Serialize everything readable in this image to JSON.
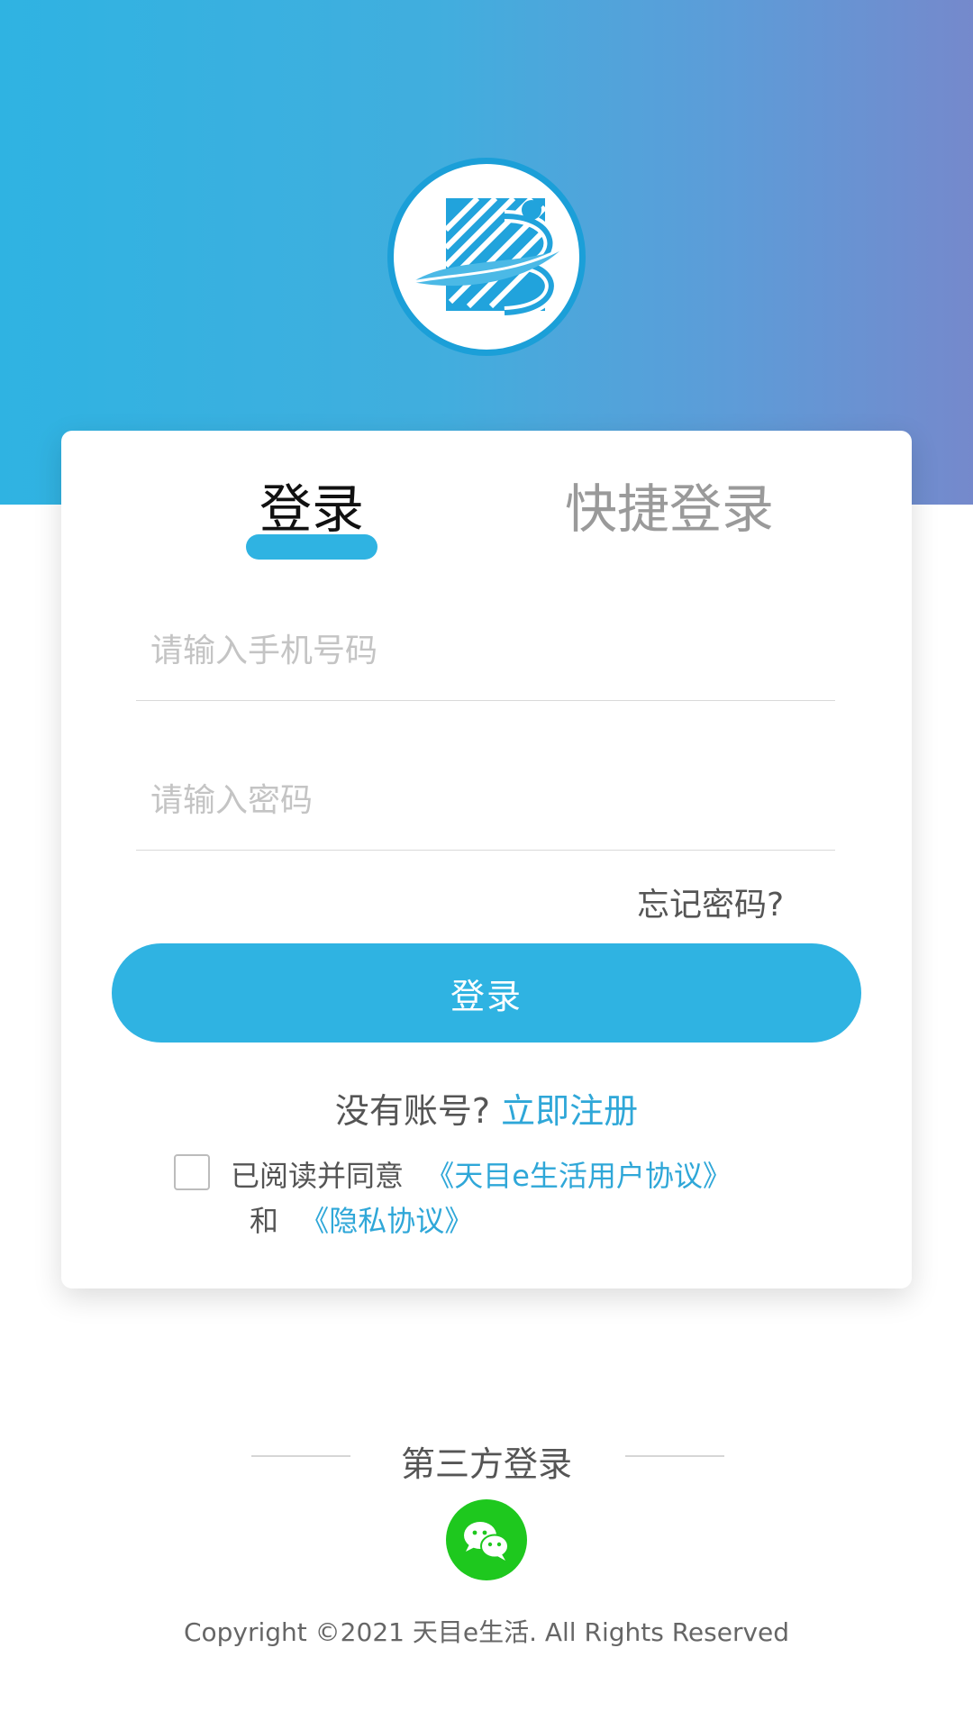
{
  "header": {
    "logo_icon": "app-logo-icon"
  },
  "tabs": [
    {
      "label": "登录",
      "active": true
    },
    {
      "label": "快捷登录",
      "active": false
    }
  ],
  "form": {
    "phone_placeholder": "请输入手机号码",
    "password_placeholder": "请输入密码",
    "forgot_label": "忘记密码?",
    "login_button": "登录"
  },
  "register": {
    "prompt": "没有账号?",
    "link": "立即注册"
  },
  "agreement": {
    "prefix": "已阅读并同意",
    "user_agreement": "《天目e生活用户协议》",
    "and": "和",
    "privacy": "《隐私协议》",
    "checked": false
  },
  "third_party": {
    "title": "第三方登录",
    "icon": "wechat-icon"
  },
  "footer": {
    "copyright": "Copyright ©2021 天目e生活. All Rights Reserved"
  },
  "colors": {
    "accent": "#2fb3e2",
    "link": "#2fa7d8",
    "wechat": "#1ec81e"
  }
}
